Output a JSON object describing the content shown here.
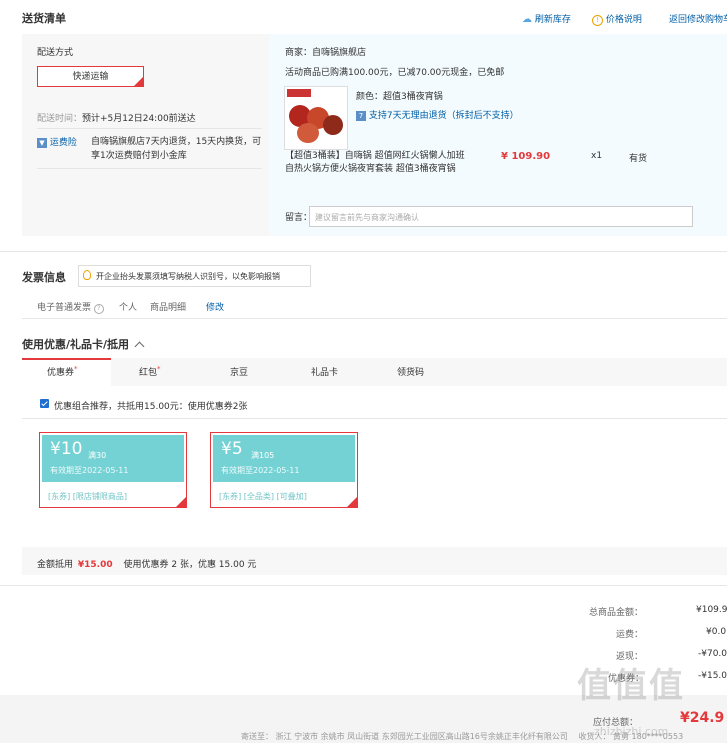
{
  "header": {
    "title": "送货清单",
    "refresh_label": "刷新库存",
    "price_note_label": "价格说明",
    "return_label": "返回修改购物车"
  },
  "shipping": {
    "label": "配送方式",
    "method": "快递运输",
    "time_label": "配送时间：",
    "time_value": "预计+5月12日24:00前送达",
    "insurance_badge": "运费险",
    "insurance_text": "自嗨锅旗舰店7天内退货，15天内换货，可享1次运费赔付到小金库"
  },
  "order": {
    "shop": "商家：自嗨锅旗舰店",
    "promo": "活动商品已购满100.00元，已减70.00元现金，已免邮",
    "color": "颜色：超值3桶夜宵锅",
    "return_policy": "支持7天无理由退货（拆封后不支持）",
    "product_name": "【超值3桶装】自嗨锅 超值网红火锅懒人加班自热火锅方便火锅夜宵套装 超值3桶夜宵锅",
    "price": "¥ 109.90",
    "qty": "x1",
    "stock": "有货",
    "memo_label": "留言：",
    "memo_placeholder": "建议留言前先与商家沟通确认"
  },
  "invoice": {
    "title": "发票信息",
    "tip": "开企业抬头发票须填写纳税人识别号，以免影响报销",
    "type": "电子普通发票",
    "person": "个人",
    "detail": "商品明细",
    "edit": "修改"
  },
  "discount": {
    "title": "使用优惠/礼品卡/抵用",
    "tabs": [
      "优惠券",
      "红包",
      "京豆",
      "礼品卡",
      "领货码"
    ],
    "recommend": "优惠组合推荐，共抵用15.00元：使用优惠券2张",
    "coupons": [
      {
        "amount": "¥10",
        "condition": "满30",
        "valid": "有效期至2022-05-11",
        "scope": "[东券] [限店铺限商品]"
      },
      {
        "amount": "¥5",
        "condition": "满105",
        "valid": "有效期至2022-05-11",
        "scope": "[东券] [全品类] [可叠加]"
      }
    ],
    "deduct_label": "金额抵用",
    "deduct_amount": "¥15.00",
    "deduct_note": "使用优惠券 2 张，优惠 15.00 元"
  },
  "summary": {
    "total_label": "总商品金额：",
    "total_value": "¥109.9",
    "freight_label": "运费：",
    "freight_value": "¥0.0",
    "cashback_label": "返现：",
    "cashback_value": "-¥70.0",
    "coupon_label": "优惠券：",
    "coupon_value": "-¥15.0"
  },
  "footer": {
    "payable_label": "应付总额：",
    "payable_value": "¥24.9",
    "ship_to_label": "寄送至：",
    "address": "浙江 宁波市 余姚市 凤山街道 东郊园光工业园区高山路16号余姚正丰化纤有限公司",
    "receiver_label": "收货人：",
    "receiver": "黄勇 180****0553"
  },
  "watermark": {
    "logo_text": "值值值",
    "site": "zhizhizhi.com"
  }
}
